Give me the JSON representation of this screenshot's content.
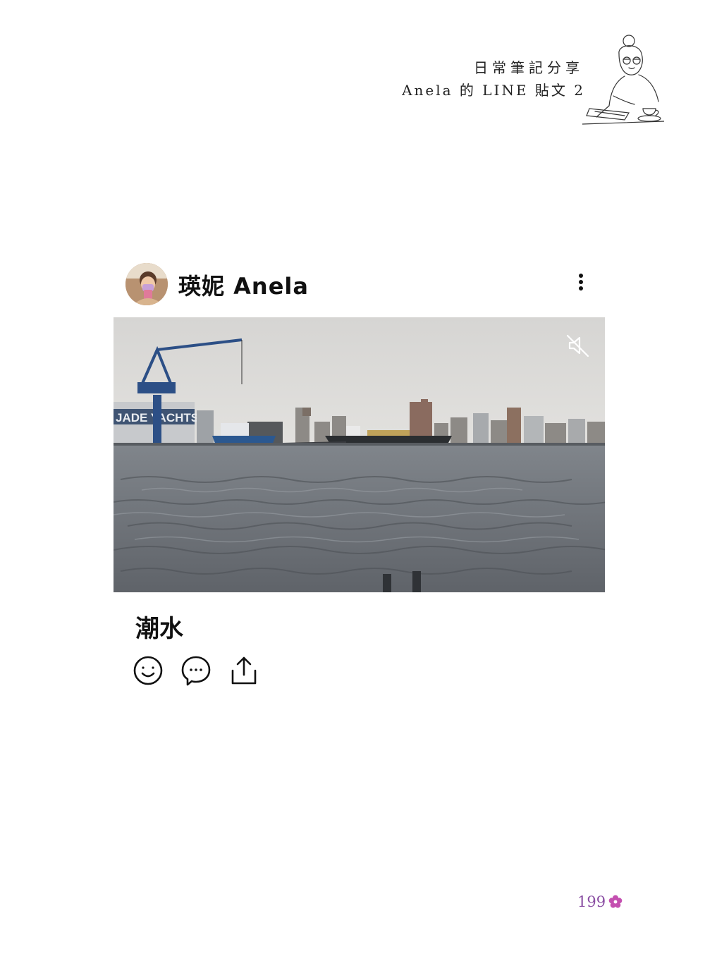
{
  "header": {
    "line1": "日常筆記分享",
    "line2": "Anela 的 LINE 貼文 2"
  },
  "post": {
    "author": "瑛妮 Anela",
    "caption": "潮水",
    "video_sign_text": "JADE YACHTS",
    "muted": true
  },
  "icons": {
    "more": "more-vertical-icon",
    "mute": "speaker-muted-icon",
    "react": "smiley-icon",
    "comment": "comment-bubble-icon",
    "share": "share-icon"
  },
  "footer": {
    "page_number": "199"
  },
  "colors": {
    "page_number": "#8a4ea3",
    "flower": "#c44fb0",
    "sky": "#d9d8d6",
    "water": "#6e7278"
  }
}
